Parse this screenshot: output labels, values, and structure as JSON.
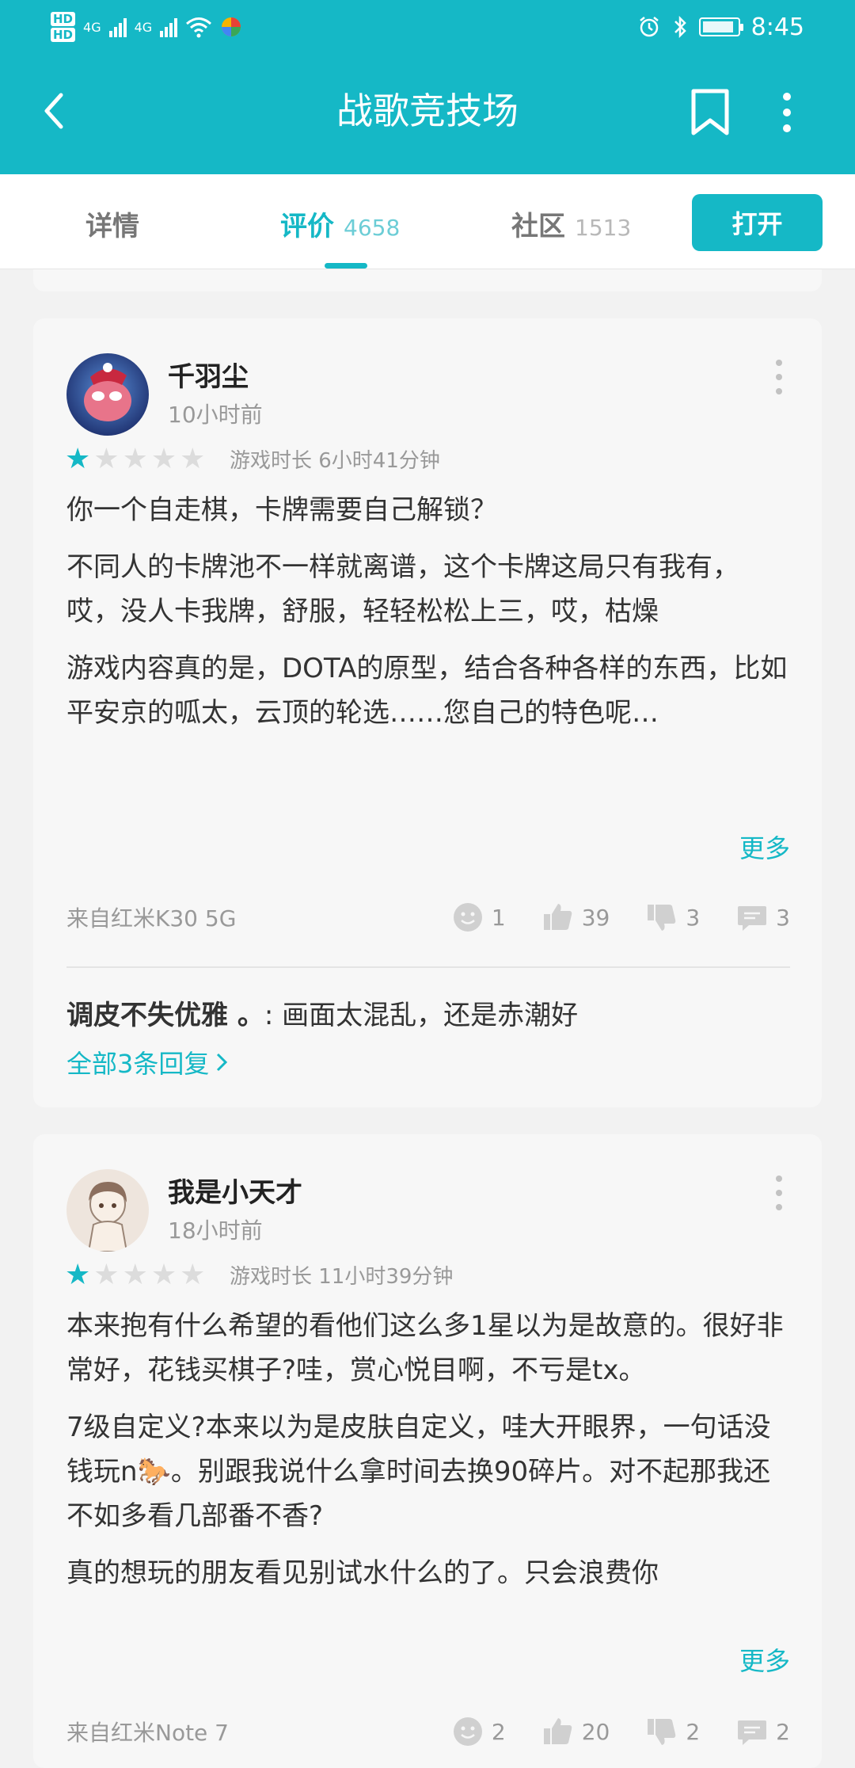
{
  "status_bar": {
    "hd1": "HD",
    "hd2": "HD",
    "net1": "4G",
    "net2": "4G",
    "time": "8:45"
  },
  "header": {
    "title": "战歌竞技场"
  },
  "tabs": [
    {
      "label": "详情",
      "count": ""
    },
    {
      "label": "评价",
      "count": "4658"
    },
    {
      "label": "社区",
      "count": "1513"
    }
  ],
  "open_button": "打开",
  "reviews": [
    {
      "username": "千羽尘",
      "time": "10小时前",
      "rating": 1,
      "playtime": "游戏时长 6小时41分钟",
      "paragraphs": [
        "你一个自走棋，卡牌需要自己解锁？",
        "不同人的卡牌池不一样就离谱，这个卡牌这局只有我有，哎，没人卡我牌，舒服，轻轻松松上三，哎，枯燥",
        "游戏内容真的是，DOTA的原型，结合各种各样的东西，比如平安京的呱太，云顶的轮选……您自己的特色呢…"
      ],
      "more": "更多",
      "device": "来自红米K30 5G",
      "fun": "1",
      "likes": "39",
      "dislikes": "3",
      "comments": "3",
      "reply_author": "调皮不失优雅 。",
      "reply_text": ": 画面太混乱，还是赤潮好",
      "all_replies": "全部3条回复"
    },
    {
      "username": "我是小天才",
      "time": "18小时前",
      "rating": 1,
      "playtime": "游戏时长 11小时39分钟",
      "paragraphs": [
        "本来抱有什么希望的看他们这么多1星以为是故意的。很好非常好，花钱买棋子?哇，赏心悦目啊，不亏是tx。",
        "7级自定义?本来以为是皮肤自定义，哇大开眼界，一句话没钱玩n🐎。别跟我说什么拿时间去换90碎片。对不起那我还不如多看几部番不香?",
        "真的想玩的朋友看见别试水什么的了。只会浪费你"
      ],
      "more": "更多",
      "device": "来自红米Note 7",
      "fun": "2",
      "likes": "20",
      "dislikes": "2",
      "comments": "2"
    }
  ],
  "colors": {
    "accent": "#15b8c6",
    "card_bg": "#f7f7f7",
    "page_bg": "#f2f2f2"
  }
}
